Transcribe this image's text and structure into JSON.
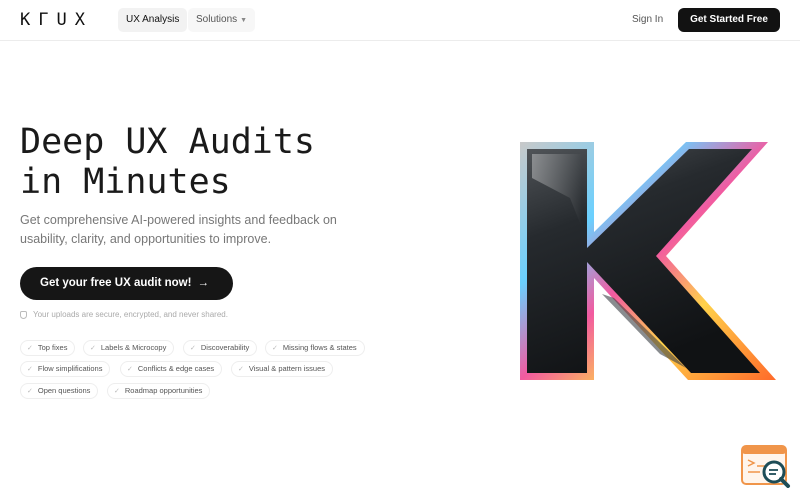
{
  "header": {
    "logo_text": "KΓUX",
    "tabs": [
      {
        "label": "UX Analysis"
      },
      {
        "label": "Solutions"
      }
    ],
    "sign_in": "Sign In",
    "cta": "Get Started Free"
  },
  "hero": {
    "title_line1": "Deep UX Audits",
    "title_line2": "in Minutes",
    "subtitle": "Get comprehensive AI-powered insights and feedback on usability, clarity, and opportunities to improve.",
    "cta": "Get your free UX audit now!",
    "cta_arrow": "→",
    "secure_note": "Your uploads are secure, encrypted, and never shared.",
    "features": [
      "Top fixes",
      "Labels & Microcopy",
      "Discoverability",
      "Missing flows & states",
      "Flow simplifications",
      "Conflicts & edge cases",
      "Visual & pattern issues",
      "Open questions",
      "Roadmap opportunities"
    ]
  },
  "icons": {
    "chevron": "chevron-down-icon",
    "check": "check-icon",
    "shield": "shield-icon",
    "hero_image": "k-logo-3d",
    "widget": "search-feedback-icon"
  },
  "colors": {
    "primary": "#121212",
    "text": "#1a1a1a",
    "muted": "#777777",
    "widget_orange": "#f0954a",
    "widget_teal": "#1e4d57"
  }
}
